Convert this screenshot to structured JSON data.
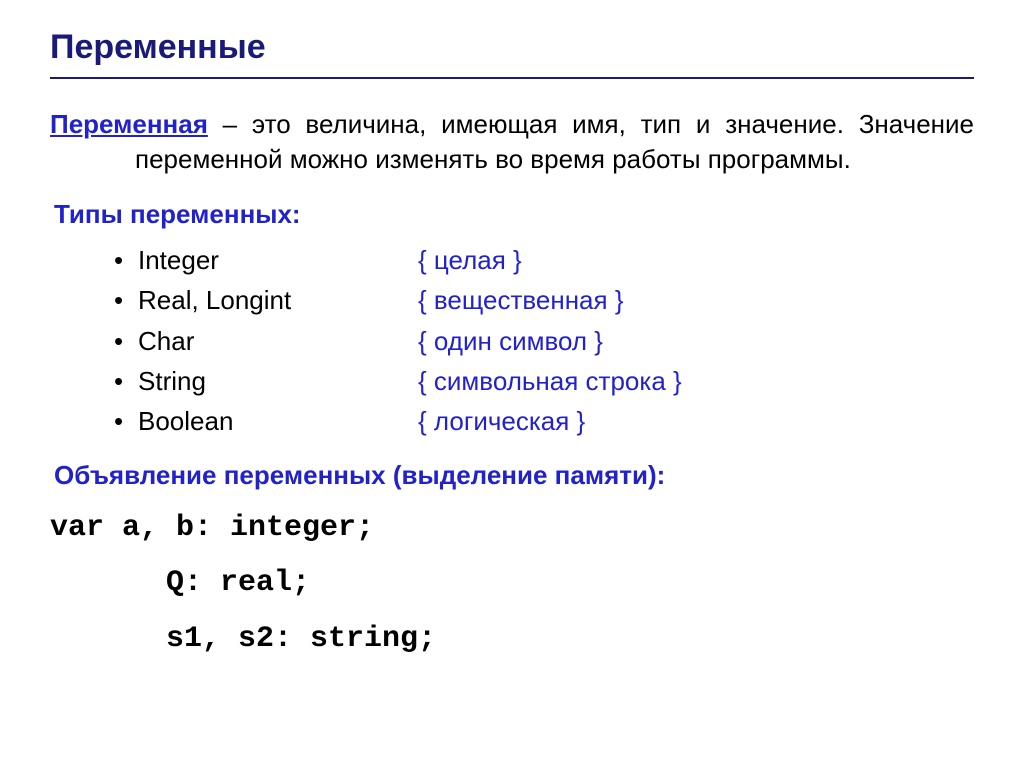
{
  "title": "Переменные",
  "definition": {
    "term": "Переменная",
    "rest": " – это величина, имеющая имя, тип и значение. Значение переменной можно изменять во время работы программы."
  },
  "typesHeading": "Типы переменных:",
  "types": [
    {
      "name": "Integer",
      "desc": "{ целая }"
    },
    {
      "name": "Real, Longint",
      "desc": "{ вещественная }"
    },
    {
      "name": "Char",
      "desc": "{ один символ }"
    },
    {
      "name": "String",
      "desc": "{ символьная строка }"
    },
    {
      "name": "Boolean",
      "desc": "{ логическая }"
    }
  ],
  "declarationHeading": "Объявление переменных (выделение памяти):",
  "code": {
    "line1": "var a, b: integer;",
    "line2": "Q: real;",
    "line3": "s1, s2: string;"
  }
}
